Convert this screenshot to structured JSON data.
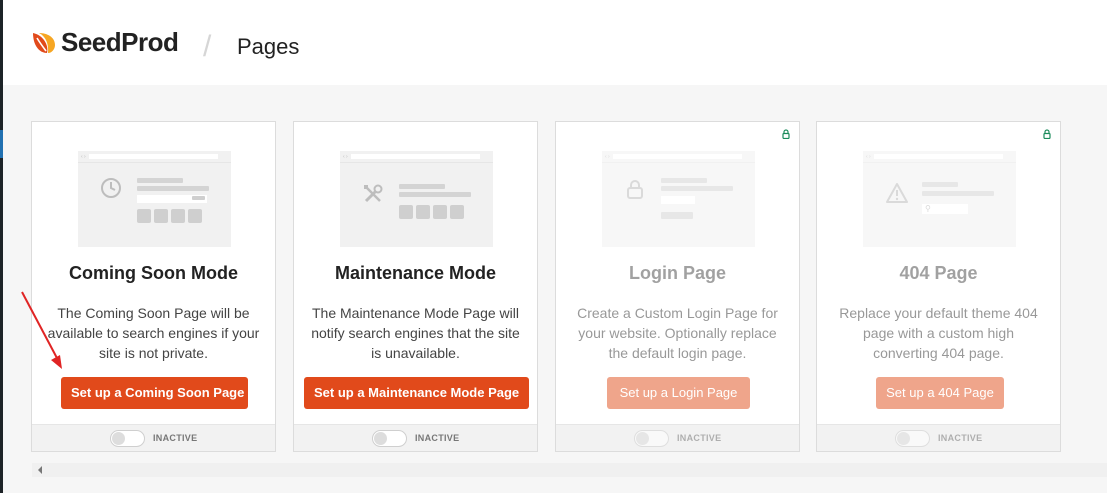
{
  "app": {
    "name": "SeedProd",
    "separator": "/",
    "page_title": "Pages"
  },
  "colors": {
    "accent": "#e14a1b",
    "accent_light": "#efa58b",
    "lock_green": "#1a8a5a"
  },
  "cards": [
    {
      "title": "Coming Soon Mode",
      "description": "The Coming Soon Page will be available to search engines if your site is not private.",
      "button": "Set up a Coming Soon Page",
      "status": "INACTIVE",
      "locked": false,
      "icon": "clock-icon"
    },
    {
      "title": "Maintenance Mode",
      "description": "The Maintenance Mode Page will notify search engines that the site is unavailable.",
      "button": "Set up a Maintenance Mode Page",
      "status": "INACTIVE",
      "locked": false,
      "icon": "tools-icon"
    },
    {
      "title": "Login Page",
      "description": "Create a Custom Login Page for your website. Optionally replace the default login page.",
      "button": "Set up a Login Page",
      "status": "INACTIVE",
      "locked": true,
      "icon": "padlock-icon"
    },
    {
      "title": "404 Page",
      "description": "Replace your default theme 404 page with a custom high converting 404 page.",
      "button": "Set up a 404 Page",
      "status": "INACTIVE",
      "locked": true,
      "icon": "warning-icon"
    }
  ]
}
